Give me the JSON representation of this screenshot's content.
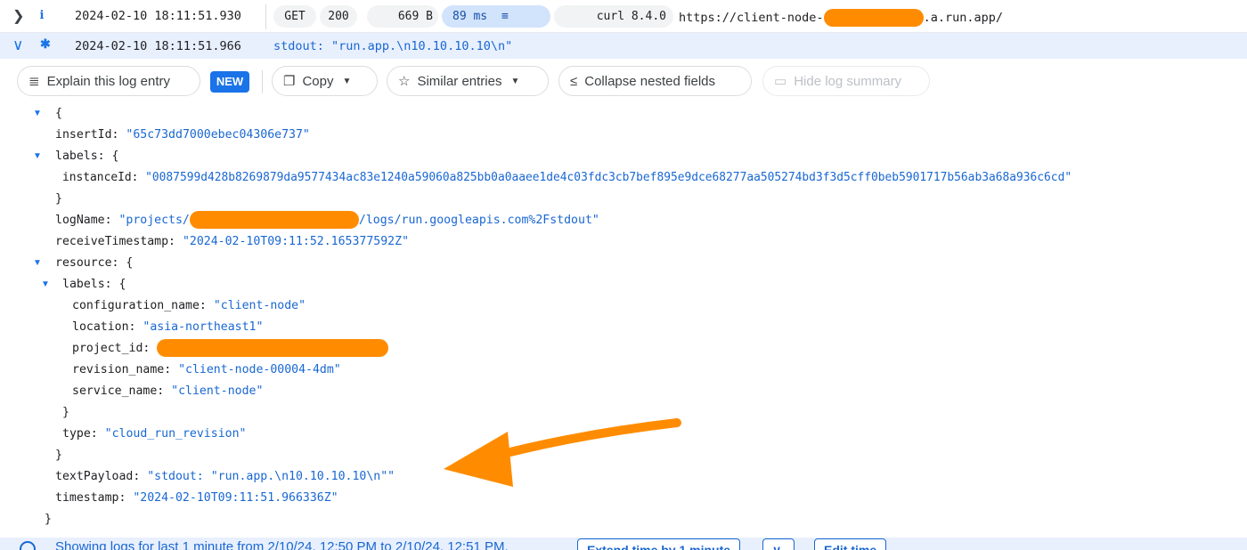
{
  "entry1": {
    "timestamp": "2024-02-10 18:11:51.930",
    "method": "GET",
    "status": "200",
    "size": "669 B",
    "latency": "89 ms",
    "user_agent": "curl 8.4.0",
    "url_prefix": "https://client-node-",
    "url_suffix": ".a.run.app/",
    "severity_icon": "info-icon",
    "expand_icon": "chevron-right-icon"
  },
  "entry2": {
    "timestamp": "2024-02-10 18:11:51.966",
    "summary": "stdout: \"run.app.\\n10.10.10.10\\n\"",
    "severity_icon": "default-severity-icon",
    "expand_icon": "chevron-down-icon"
  },
  "toolbar": {
    "explain_label": "Explain this log entry",
    "new_badge": "NEW",
    "copy_label": "Copy",
    "similar_label": "Similar entries",
    "collapse_label": "Collapse nested fields",
    "hide_summary_label": "Hide log summary"
  },
  "json": {
    "open_brace": "{",
    "insertId_key": "insertId",
    "insertId_val": "\"65c73dd7000ebec04306e737\"",
    "labels_key": "labels",
    "labels_open": ": {",
    "instanceId_key": "instanceId",
    "instanceId_val": "\"0087599d428b8269879da9577434ac83e1240a59060a825bb0a0aaee1de4c03fdc3cb7bef895e9dce68277aa505274bd3f3d5cff0beb5901717b56ab3a68a936c6cd\"",
    "close_brace": "}",
    "logName_key": "logName",
    "logName_prefix": "\"projects/",
    "logName_suffix": "/logs/run.googleapis.com%2Fstdout\"",
    "receiveTimestamp_key": "receiveTimestamp",
    "receiveTimestamp_val": "\"2024-02-10T09:11:52.165377592Z\"",
    "resource_key": "resource",
    "configuration_name_key": "configuration_name",
    "configuration_name_val": "\"client-node\"",
    "location_key": "location",
    "location_val": "\"asia-northeast1\"",
    "project_id_key": "project_id",
    "revision_name_key": "revision_name",
    "revision_name_val": "\"client-node-00004-4dm\"",
    "service_name_key": "service_name",
    "service_name_val": "\"client-node\"",
    "type_key": "type",
    "type_val": "\"cloud_run_revision\"",
    "textPayload_key": "textPayload",
    "textPayload_val": "\"stdout: \"run.app.\\n10.10.10.10\\n\"\"",
    "timestamp_key": "timestamp",
    "timestamp_val": "\"2024-02-10T09:11:51.966336Z\""
  },
  "bottom": {
    "text": "Showing logs for last 1 minute from 2/10/24, 12:50 PM to 2/10/24, 12:51 PM.",
    "extend_label": "Extend time by 1 minute",
    "edit_label": "Edit time"
  },
  "colors": {
    "accent": "#1a73e8",
    "string_value": "#1967d2",
    "redaction": "#ff8c00",
    "selected_row": "#e8f0fe"
  }
}
